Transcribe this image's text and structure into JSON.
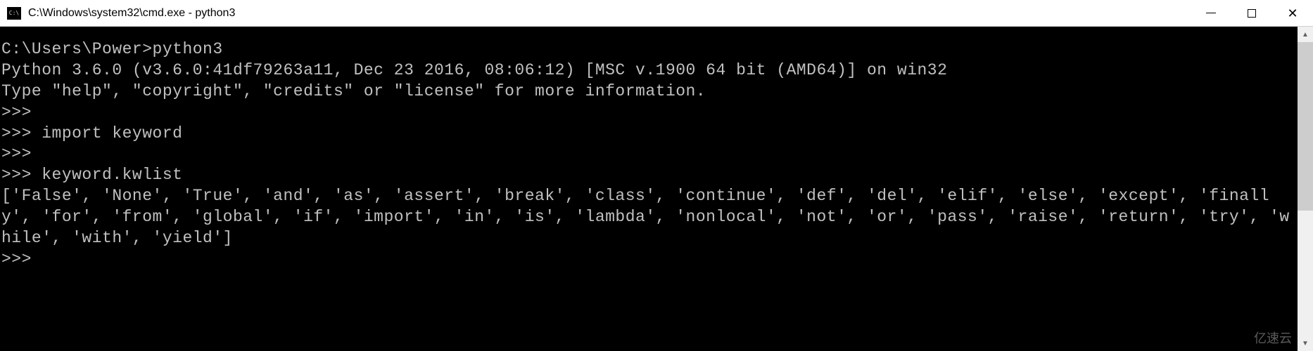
{
  "titlebar": {
    "icon_label": "C:\\",
    "title": "C:\\Windows\\system32\\cmd.exe - python3"
  },
  "terminal": {
    "prompt_line": "C:\\Users\\Power>python3",
    "version_line": "Python 3.6.0 (v3.6.0:41df79263a11, Dec 23 2016, 08:06:12) [MSC v.1900 64 bit (AMD64)] on win32",
    "help_line": "Type \"help\", \"copyright\", \"credits\" or \"license\" for more information.",
    "repl_prompt": ">>>",
    "import_line": ">>> import keyword",
    "kwlist_line": ">>> keyword.kwlist",
    "kwlist_output": "['False', 'None', 'True', 'and', 'as', 'assert', 'break', 'class', 'continue', 'def', 'del', 'elif', 'else', 'except', 'finally', 'for', 'from', 'global', 'if', 'import', 'in', 'is', 'lambda', 'nonlocal', 'not', 'or', 'pass', 'raise', 'return', 'try', 'while', 'with', 'yield']"
  },
  "watermark": "亿速云"
}
